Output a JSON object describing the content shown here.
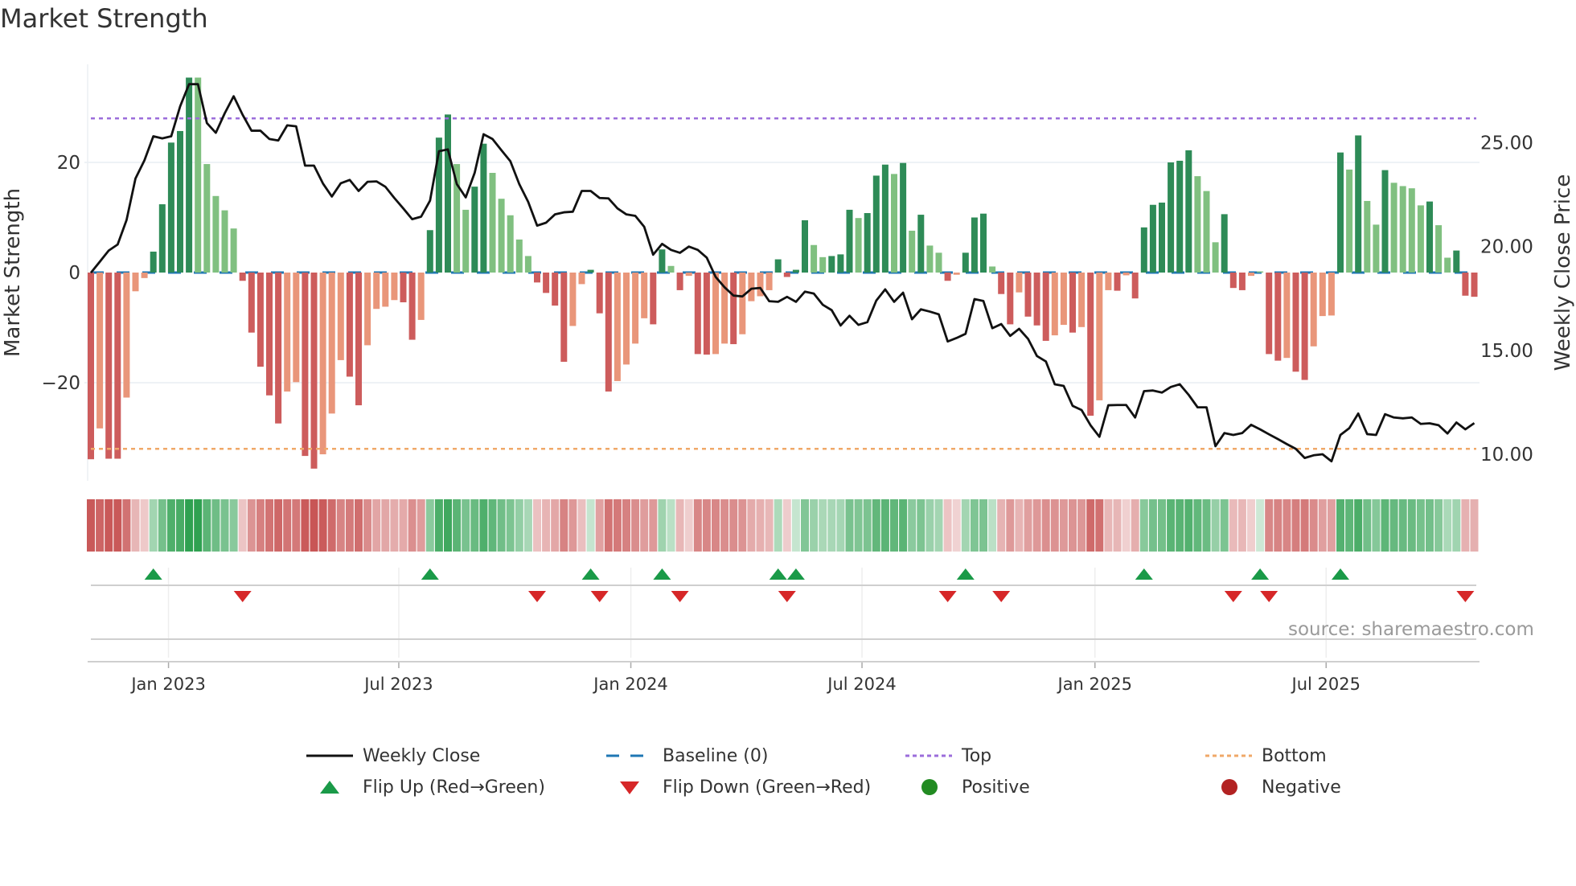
{
  "title": "Market Strength",
  "source": "source: sharemaestro.com",
  "legend": {
    "weekly_close": "Weekly Close",
    "baseline": "Baseline (0)",
    "top": "Top",
    "bottom": "Bottom",
    "flip_up": "Flip Up (Red→Green)",
    "flip_down": "Flip Down (Green→Red)",
    "positive": "Positive",
    "negative": "Negative"
  },
  "colors": {
    "pos_rising": "#2e8b57",
    "pos_falling": "#80c080",
    "neg_falling": "#cd5c5c",
    "neg_rising": "#e9967a",
    "price": "#111111",
    "baseline": "#1f77b4",
    "top": "#9b6ddb",
    "bottom": "#f0a868",
    "flip_up": "#1a9a48",
    "flip_down": "#d62728",
    "positive": "#228b22",
    "negative": "#b22222"
  },
  "chart_data": {
    "type": "bar",
    "title": "Market Strength",
    "ylabel": "Market Strength",
    "y2label": "Weekly Close Price",
    "ylim": [
      -39,
      38
    ],
    "y2lim": [
      8.7,
      28.7
    ],
    "yticks": [
      {
        "v": -20,
        "label": "−20"
      },
      {
        "v": 0,
        "label": "0"
      },
      {
        "v": 20,
        "label": "20"
      }
    ],
    "y2ticks": [
      {
        "v": 10,
        "label": "10.00"
      },
      {
        "v": 15,
        "label": "15.00"
      },
      {
        "v": 20,
        "label": "20.00"
      },
      {
        "v": 25,
        "label": "25.00"
      }
    ],
    "xticks": [
      {
        "week": 8.7,
        "label": "Jan 2023"
      },
      {
        "week": 34.5,
        "label": "Jul 2023"
      },
      {
        "week": 60.5,
        "label": "Jan 2024"
      },
      {
        "week": 86.4,
        "label": "Jul 2024"
      },
      {
        "week": 112.5,
        "label": "Jan 2025"
      },
      {
        "week": 138.4,
        "label": "Jul 2025"
      }
    ],
    "top_level": 28,
    "bottom_level": -32,
    "grid": true,
    "legend_position": "bottom",
    "strength": [
      -33.9,
      -28.3,
      -33.8,
      -33.8,
      -22.7,
      -3.4,
      -1,
      3.8,
      12.4,
      23.6,
      25.7,
      35.4,
      35.4,
      19.7,
      13.9,
      11.3,
      8,
      -1.5,
      -10.9,
      -17.1,
      -22.3,
      -27.4,
      -21.6,
      -19.9,
      -33.3,
      -35.6,
      -33,
      -25.6,
      -15.9,
      -18.9,
      -24.1,
      -13.2,
      -6.6,
      -6.2,
      -5,
      -5.4,
      -12.2,
      -8.6,
      7.7,
      24.5,
      28.7,
      19.7,
      11.4,
      15.6,
      23.4,
      18.1,
      13.4,
      10.4,
      6,
      3,
      -1.8,
      -3.7,
      -6,
      -16.2,
      -9.7,
      -2.1,
      0.5,
      -7.4,
      -21.6,
      -19.7,
      -16.7,
      -12.9,
      -8.3,
      -9.4,
      4.2,
      1.2,
      -3.2,
      -0.6,
      -14.8,
      -14.9,
      -14.8,
      -12.9,
      -13,
      -11.2,
      -5.2,
      -4.3,
      -3.2,
      2.4,
      -0.8,
      0.5,
      9.5,
      5,
      2.8,
      3,
      3.3,
      11.4,
      9.9,
      10.8,
      17.6,
      19.6,
      17.9,
      19.9,
      7.6,
      10.5,
      4.9,
      3.6,
      -1.5,
      -0.4,
      3.6,
      10,
      10.7,
      1.1,
      -3.9,
      -9.4,
      -3.6,
      -8,
      -9.6,
      -12.4,
      -11.4,
      -9.5,
      -10.9,
      -9.9,
      -26,
      -23.2,
      -3.2,
      -3.3,
      -0.5,
      -4.7,
      8.2,
      12.3,
      12.7,
      20,
      20.3,
      22.2,
      17.5,
      14.8,
      5.5,
      10.6,
      -2.8,
      -3.2,
      -0.6,
      0.2,
      -14.8,
      -16,
      -15.5,
      -18,
      -19.5,
      -13.4,
      -7.9,
      -7.8,
      21.8,
      18.7,
      24.9,
      13,
      8.7,
      18.6,
      16.3,
      15.7,
      15.3,
      12.2,
      12.9,
      8.6,
      2.7,
      4,
      -4.2,
      -4.4
    ],
    "momentum": "dlddlllddd",
    "momentum_rest": "ddlllllddd|ddllddllld|dllllddldd|dllddlllll|ddddlldddl|lllddldldd|lldllllddd|dlldddlddd|ldldlldldd|dlddldddll|dldlldlddd|ddddlllddd|llddlddlll|dldlldllll|dllddd",
    "weekly_close": [
      18.74,
      19.27,
      19.81,
      20.1,
      21.28,
      23.28,
      24.15,
      25.31,
      25.21,
      25.31,
      26.75,
      27.82,
      27.82,
      25.95,
      25.48,
      26.42,
      27.24,
      26.35,
      25.58,
      25.58,
      25.18,
      25.11,
      25.84,
      25.79,
      23.9,
      23.9,
      23.04,
      22.41,
      23.05,
      23.21,
      22.68,
      23.12,
      23.14,
      22.88,
      22.34,
      21.84,
      21.32,
      21.44,
      22.21,
      24.59,
      24.68,
      23.01,
      22.37,
      23.55,
      25.41,
      25.18,
      24.64,
      24.11,
      23.01,
      22.15,
      21.01,
      21.15,
      21.55,
      21.65,
      21.68,
      22.68,
      22.68,
      22.34,
      22.32,
      21.84,
      21.55,
      21.48,
      20.95,
      19.61,
      20.13,
      19.84,
      19.7,
      20,
      19.84,
      19.47,
      18.54,
      18.04,
      17.64,
      17.6,
      17.97,
      18.01,
      17.37,
      17.34,
      17.58,
      17.34,
      17.83,
      17.74,
      17.2,
      16.94,
      16.2,
      16.67,
      16.23,
      16.36,
      17.4,
      17.94,
      17.34,
      17.78,
      16.5,
      16.98,
      16.87,
      16.74,
      15.43,
      15.6,
      15.8,
      17.47,
      17.38,
      16.07,
      16.27,
      15.7,
      16.04,
      15.56,
      14.73,
      14.47,
      13.37,
      13.29,
      12.33,
      12.13,
      11.4,
      10.84,
      12.36,
      12.37,
      12.37,
      11.77,
      13.04,
      13.07,
      12.97,
      13.24,
      13.37,
      12.86,
      12.26,
      12.26,
      10.39,
      11.02,
      10.93,
      11.02,
      11.42,
      11.2,
      10.96,
      10.73,
      10.49,
      10.26,
      9.82,
      9.95,
      10,
      9.66,
      10.93,
      11.26,
      11.96,
      10.97,
      10.93,
      11.93,
      11.77,
      11.73,
      11.77,
      11.46,
      11.49,
      11.4,
      11,
      11.53,
      11.2,
      11.5
    ]
  }
}
